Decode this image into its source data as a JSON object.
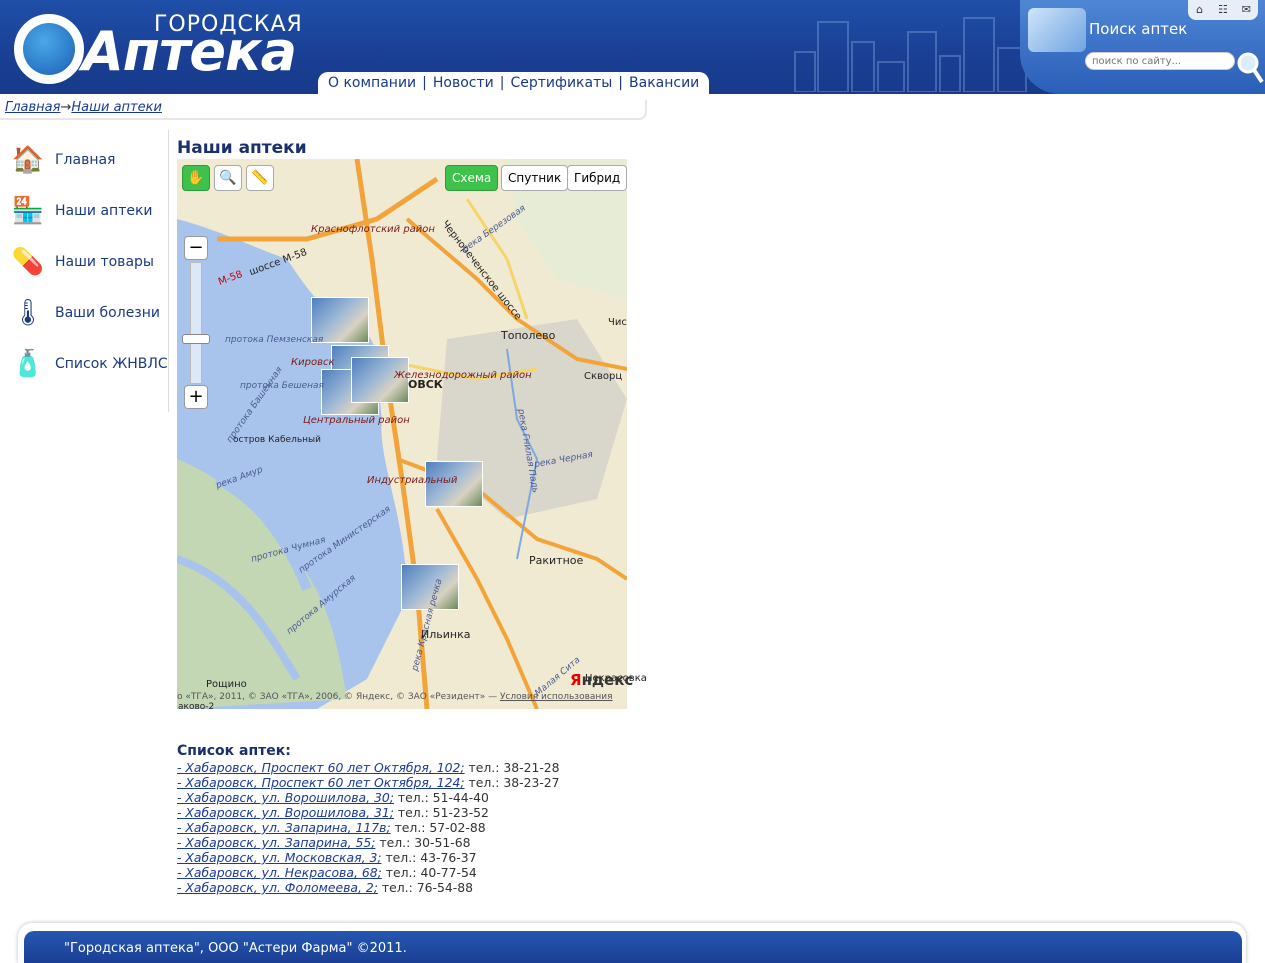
{
  "header": {
    "logo_small": "ГОРОДСКАЯ",
    "logo_big": "Аптека",
    "nav": [
      "О компании",
      "Новости",
      "Сертификаты",
      "Вакансии"
    ],
    "search_title": "Поиск аптек",
    "search_placeholder": "поиск по сайту..."
  },
  "breadcrumb": {
    "home": "Главная",
    "arrow": "→",
    "current": "Наши аптеки"
  },
  "sidebar": {
    "items": [
      {
        "label": "Главная",
        "icon": "house-icon"
      },
      {
        "label": "Наши аптеки",
        "icon": "pharmacy-store-icon"
      },
      {
        "label": "Наши товары",
        "icon": "pills-icon"
      },
      {
        "label": "Ваши болезни",
        "icon": "thermometer-icon"
      },
      {
        "label": "Список ЖНВЛС",
        "icon": "medicine-bottles-icon"
      }
    ]
  },
  "main": {
    "title": "Наши аптеки",
    "map": {
      "types": [
        "Схема",
        "Спутник",
        "Гибрид"
      ],
      "active_type": "Схема",
      "labels": {
        "krasnoflotsky": "Краснофлотский район",
        "m58_sign": "М-58",
        "m58_road": "шоссе М-58",
        "chernorechenskoe": "Чернореченское шоссе",
        "berezovaya": "река Березовая",
        "topolevo": "Тополево",
        "chis": "Чис",
        "pemzenskaya": "протока Пемзенская",
        "kirovsk": "Кировск",
        "zhd": "Железнодорожный район",
        "city": "ОВСК",
        "skvorts": "Скворц",
        "beshenaya": "протока Бешеная",
        "bashennaya": "протока Башенная",
        "centralny": "Центральный район",
        "kabelny": "остров Кабельный",
        "gnilaya": "река Гнилая Падь",
        "chernaya": "река Черная",
        "amur": "река Амур",
        "industrial": "Индустриальный",
        "chumnaya": "протока Чумная",
        "ministerskaya": "протока Министерская",
        "rakitnoe": "Ракитное",
        "amurskaya": "протока Амурская",
        "krasnaya": "река Красная речка",
        "ilinka": "Ильинка",
        "sita": "Малая Сита",
        "nekrasovka": "Некрасовка",
        "roshino": "Рощино",
        "novo2": "аково-2"
      },
      "copyright": "о «ТГА», 2011, © ЗАО «ТГА», 2006, © Яндекс, © ЗАО «Резидент» — ",
      "terms": "Условия использования",
      "brand": "Яндекс"
    },
    "list_title": "Список аптек:",
    "pharmacies": [
      {
        "address": "- Хабаровск, Проспект 60 лет Октября, 102;",
        "phone": "тел.: 38-21-28"
      },
      {
        "address": "- Хабаровск, Проспект 60 лет Октября, 124;",
        "phone": "тел.: 38-23-27"
      },
      {
        "address": "- Хабаровск, ул. Ворошилова, 30;",
        "phone": "тел.: 51-44-40"
      },
      {
        "address": "- Хабаровск, ул. Ворошилова, 31;",
        "phone": "тел.: 51-23-52"
      },
      {
        "address": "- Хабаровск, ул. Запарина, 117в;",
        "phone": "тел.: 57-02-88"
      },
      {
        "address": "- Хабаровск, ул. Запарина, 55;",
        "phone": "тел.: 30-51-68"
      },
      {
        "address": "- Хабаровск, ул. Московская, 3;",
        "phone": "тел.: 43-76-37"
      },
      {
        "address": "- Хабаровск, ул. Некрасова, 68;",
        "phone": "тел.: 40-77-54"
      },
      {
        "address": "- Хабаровск, ул. Фоломеева, 2;",
        "phone": "тел.: 76-54-88"
      }
    ]
  },
  "footer": {
    "text": "\"Городская аптека\", ООО \"Астери Фарма\" ©2011."
  },
  "colors": {
    "brand_blue": "#1a3f94",
    "link": "#1a3a9a",
    "map_active": "#3fc24b"
  }
}
